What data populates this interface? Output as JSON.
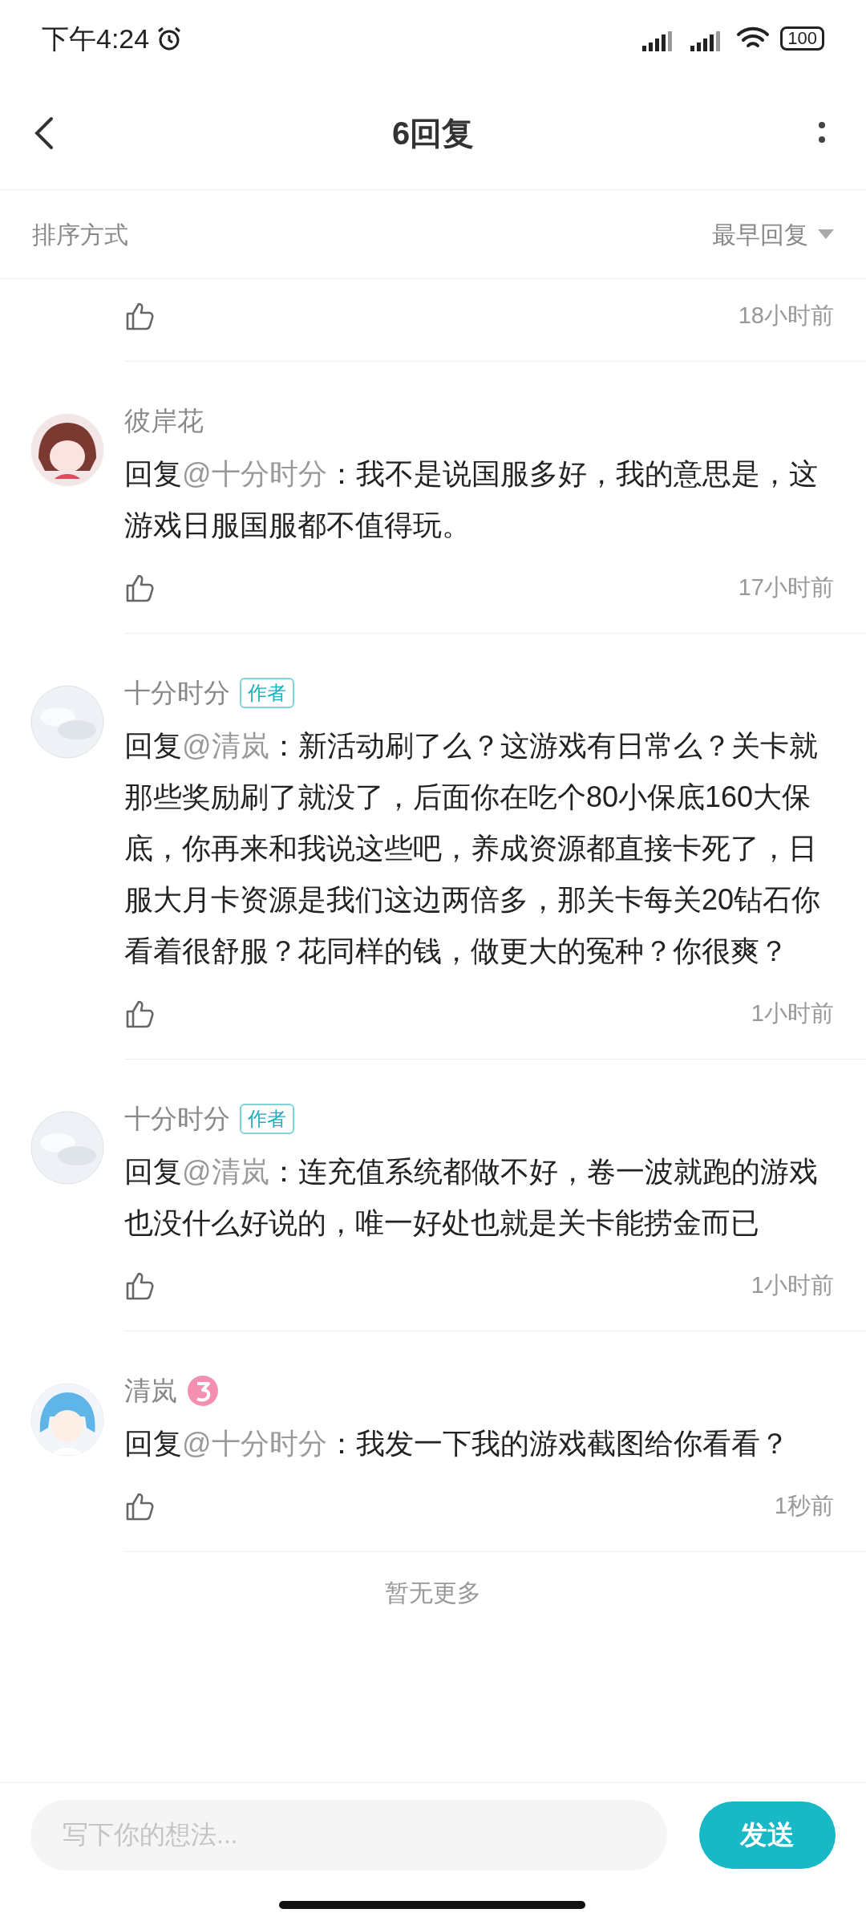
{
  "status_bar": {
    "time": "下午4:24",
    "battery": "100"
  },
  "header": {
    "title": "6回复"
  },
  "sort_bar": {
    "label": "排序方式",
    "value": "最早回复"
  },
  "comments": [
    {
      "kind": "cut_off",
      "time": "18小时前"
    },
    {
      "kind": "reply",
      "author": "彼岸花",
      "reply_prefix": "回复",
      "mention": "@十分时分",
      "text": "：我不是说国服多好，我的意思是，这游戏日服国服都不值得玩。",
      "time": "17小时前"
    },
    {
      "kind": "reply",
      "author": "十分时分",
      "badge": {
        "kind": "author",
        "text": "作者"
      },
      "reply_prefix": "回复",
      "mention": "@清岚",
      "text": "：新活动刷了么？这游戏有日常么？关卡就那些奖励刷了就没了，后面你在吃个80小保底160大保底，你再来和我说这些吧，养成资源都直接卡死了，日服大月卡资源是我们这边两倍多，那关卡每关20钻石你看着很舒服？花同样的钱，做更大的冤种？你很爽？",
      "time": "1小时前"
    },
    {
      "kind": "reply",
      "author": "十分时分",
      "badge": {
        "kind": "author",
        "text": "作者"
      },
      "reply_prefix": "回复",
      "mention": "@清岚",
      "text": "：连充值系统都做不好，卷一波就跑的游戏也没什么好说的，唯一好处也就是关卡能捞金而已",
      "time": "1小时前"
    },
    {
      "kind": "reply",
      "author": "清岚",
      "badge": {
        "kind": "level"
      },
      "reply_prefix": "回复",
      "mention": "@十分时分",
      "text": "：我发一下我的游戏截图给你看看？",
      "time": "1秒前"
    }
  ],
  "end_text": "暂无更多",
  "composer": {
    "placeholder": "写下你的想法...",
    "send": "发送"
  }
}
